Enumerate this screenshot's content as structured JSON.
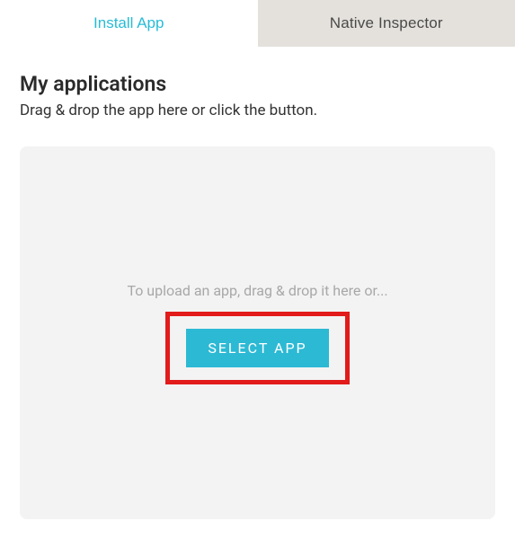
{
  "tabs": {
    "install": "Install App",
    "inspector": "Native Inspector"
  },
  "page": {
    "heading": "My applications",
    "subheading": "Drag & drop the app here or click the button."
  },
  "dropzone": {
    "hint": "To upload an app, drag & drop it here or...",
    "button_label": "SELECT APP"
  }
}
